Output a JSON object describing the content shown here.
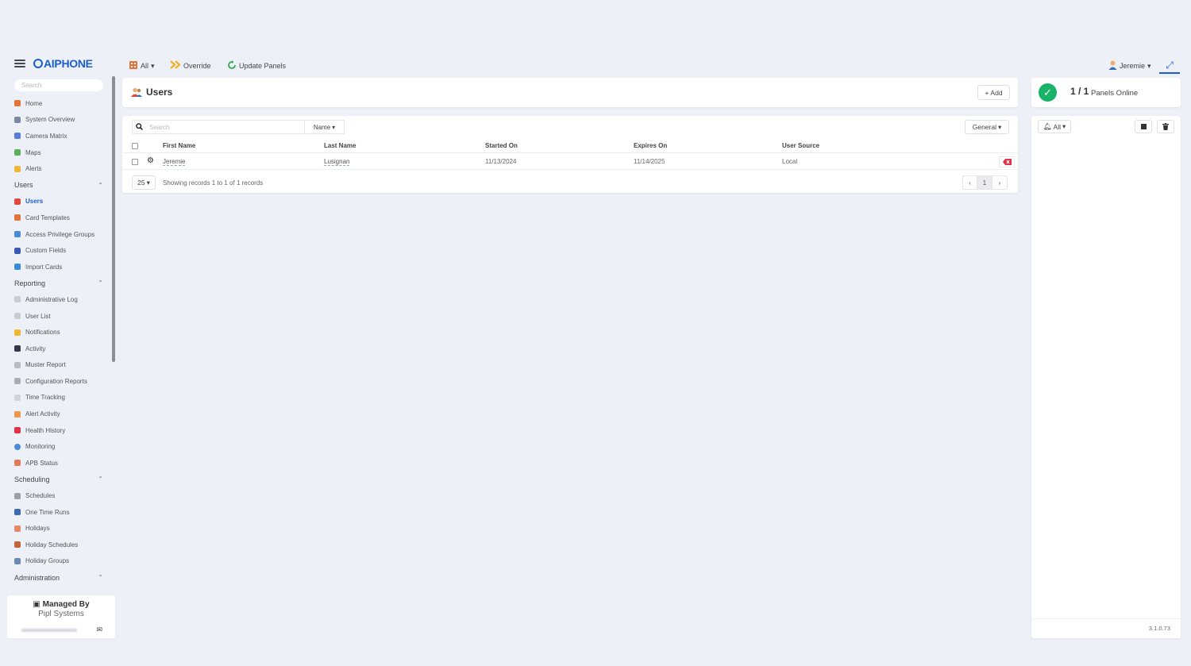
{
  "topbar": {
    "logo": "AIPHONE",
    "filter_label": "All",
    "override_label": "Override",
    "update_panels_label": "Update Panels",
    "user_name": "Jeremie"
  },
  "sidebar": {
    "search_placeholder": "Search",
    "items": [
      {
        "label": "Home",
        "icon": "home-icon",
        "color": "#e0743a"
      },
      {
        "label": "System Overview",
        "icon": "network-icon",
        "color": "#7a8aa0"
      },
      {
        "label": "Camera Matrix",
        "icon": "camera-icon",
        "color": "#5a7bd6"
      },
      {
        "label": "Maps",
        "icon": "map-icon",
        "color": "#5bb05b"
      },
      {
        "label": "Alerts",
        "icon": "bell-icon",
        "color": "#f2b632"
      }
    ],
    "sections": {
      "users": {
        "label": "Users",
        "items": [
          {
            "label": "Users",
            "icon": "users-icon",
            "color": "#e04a3a",
            "active": true
          },
          {
            "label": "Card Templates",
            "icon": "card-icon",
            "color": "#e0743a"
          },
          {
            "label": "Access Privilege Groups",
            "icon": "key-group-icon",
            "color": "#4a8ad6"
          },
          {
            "label": "Custom Fields",
            "icon": "fields-icon",
            "color": "#3a5ab0"
          },
          {
            "label": "Import Cards",
            "icon": "import-icon",
            "color": "#3a8ad6"
          }
        ]
      },
      "reporting": {
        "label": "Reporting",
        "items": [
          {
            "label": "Administrative Log",
            "icon": "log-icon",
            "color": "#c8ccd4"
          },
          {
            "label": "User List",
            "icon": "list-icon",
            "color": "#c8ccd4"
          },
          {
            "label": "Notifications",
            "icon": "bell-icon",
            "color": "#f2b632"
          },
          {
            "label": "Activity",
            "icon": "activity-icon",
            "color": "#33374a"
          },
          {
            "label": "Muster Report",
            "icon": "muster-icon",
            "color": "#b8bcc6"
          },
          {
            "label": "Configuration Reports",
            "icon": "config-icon",
            "color": "#a8acb6"
          },
          {
            "label": "Time Tracking",
            "icon": "clock-icon",
            "color": "#d0d4dc"
          },
          {
            "label": "Alert Activity",
            "icon": "alert-activity-icon",
            "color": "#e89a4a"
          },
          {
            "label": "Health History",
            "icon": "heart-icon",
            "color": "#e0334a"
          },
          {
            "label": "Monitoring",
            "icon": "monitor-icon",
            "color": "#4a8ad6"
          },
          {
            "label": "APB Status",
            "icon": "apb-icon",
            "color": "#e07a5a"
          }
        ]
      },
      "scheduling": {
        "label": "Scheduling",
        "items": [
          {
            "label": "Schedules",
            "icon": "schedule-icon",
            "color": "#9aa0ac"
          },
          {
            "label": "One Time Runs",
            "icon": "run-icon",
            "color": "#3a6ab0"
          },
          {
            "label": "Holidays",
            "icon": "holiday-icon",
            "color": "#e08a6a"
          },
          {
            "label": "Holiday Schedules",
            "icon": "holiday-schedule-icon",
            "color": "#c0643a"
          },
          {
            "label": "Holiday Groups",
            "icon": "holiday-group-icon",
            "color": "#6a8ab0"
          }
        ]
      },
      "administration": {
        "label": "Administration"
      }
    },
    "managed": {
      "title": "Managed By",
      "company": "Pipl Systems"
    }
  },
  "users_page": {
    "title": "Users",
    "add_label": "Add",
    "search_placeholder": "Search",
    "search_field": "Name",
    "view_label": "General",
    "columns": [
      "First Name",
      "Last Name",
      "Started On",
      "Expires On",
      "User Source"
    ],
    "rows": [
      {
        "first_name": "Jeremie",
        "last_name": "Lusignan",
        "started_on": "11/13/2024",
        "expires_on": "11/14/2025",
        "user_source": "Local"
      }
    ],
    "page_size": "25",
    "records_info": "Showing records 1 to 1 of 1 records",
    "current_page": "1"
  },
  "right_panel": {
    "panels_ratio": "1 / 1",
    "panels_label": "Panels Online",
    "filter_label": "All",
    "version": "3.1.0.73",
    "status_color": "#18b368"
  }
}
